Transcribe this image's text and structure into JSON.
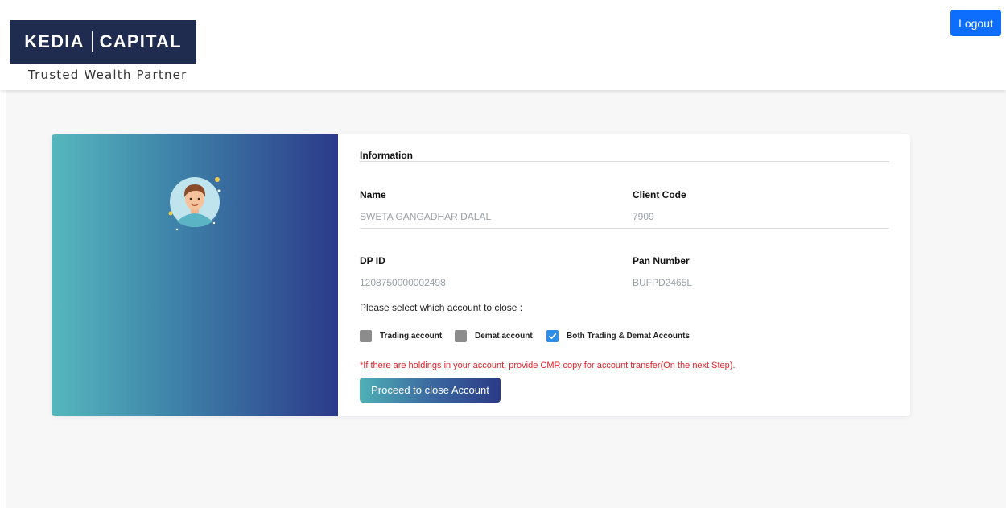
{
  "header": {
    "brand_left": "KEDIA",
    "brand_right": "CAPITAL",
    "tagline": "Trusted Wealth Partner",
    "logout_label": "Logout"
  },
  "info": {
    "section_title": "Information",
    "name_label": "Name",
    "name_value": "SWETA GANGADHAR DALAL",
    "client_code_label": "Client Code",
    "client_code_value": "7909",
    "dp_id_label": "DP ID",
    "dp_id_value": "1208750000002498",
    "pan_label": "Pan Number",
    "pan_value": "BUFPD2465L"
  },
  "close_form": {
    "prompt": "Please select which account to close :",
    "options": [
      {
        "label": "Trading account",
        "checked": false
      },
      {
        "label": "Demat account",
        "checked": false
      },
      {
        "label": "Both Trading & Demat Accounts",
        "checked": true
      }
    ],
    "note": "*If there are holdings in your account, provide CMR copy for account transfer(On the next Step).",
    "proceed_label": "Proceed to close Account"
  },
  "colors": {
    "accent_blue": "#0d6efd",
    "gradient_start": "#55b7bd",
    "gradient_end": "#2c3a8a",
    "note_red": "#e0242b",
    "logo_bg": "#1f2b4f"
  }
}
